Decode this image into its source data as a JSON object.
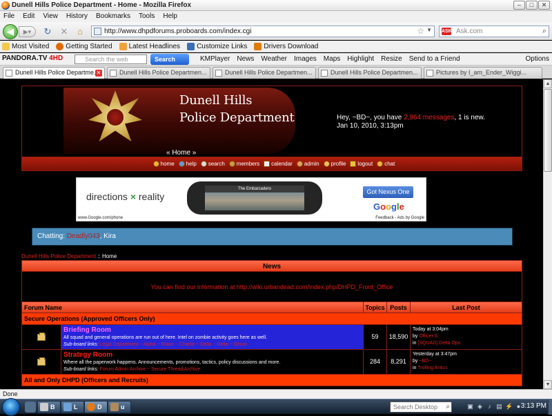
{
  "window": {
    "title": "Dunell Hills Police Department - Home - Mozilla Firefox"
  },
  "menu": [
    "File",
    "Edit",
    "View",
    "History",
    "Bookmarks",
    "Tools",
    "Help"
  ],
  "navbar": {
    "url": "http://www.dhpdforums.proboards.com/index.cgi",
    "search_placeholder": "Ask.com",
    "search_engine_label": "ASK"
  },
  "bookmarks": [
    {
      "label": "Most Visited",
      "icon": "folder-icon",
      "color": "#f2c94c"
    },
    {
      "label": "Getting Started",
      "icon": "firefox-icon",
      "color": "#e06a00"
    },
    {
      "label": "Latest Headlines",
      "icon": "rss-icon",
      "color": "#f2a23a"
    },
    {
      "label": "Customize Links",
      "icon": "page-icon",
      "color": "#3a6fb5"
    },
    {
      "label": "Drivers Download",
      "icon": "driver-icon",
      "color": "#e07b00"
    }
  ],
  "toolbar2": {
    "pandora": "PANDORA.TV",
    "pandora_4hd": "4HD",
    "search_placeholder": "Search the web",
    "search_button": "Search",
    "items": [
      "KMPlayer",
      "News",
      "Weather",
      "Images",
      "Maps",
      "Highlight",
      "Resize",
      "Send to a Friend"
    ],
    "options": "Options"
  },
  "tabs": [
    {
      "label": "Dunell Hills Police Departme...",
      "active": true
    },
    {
      "label": "Dunell Hills Police Departmen...",
      "active": false
    },
    {
      "label": "Dunell Hills Police Departmen...",
      "active": false
    },
    {
      "label": "Dunell Hills Police Departmen...",
      "active": false
    },
    {
      "label": "Pictures by I_am_Ender_Wiggi...",
      "active": false
    }
  ],
  "header": {
    "dept_line1": "Dunell Hills",
    "dept_line2": "Police Department",
    "greeting": "Hey, ~BD~, you have",
    "messages_count": "2,964 messages",
    "new_text": ", 1 is new.",
    "date": "Jan 10, 2010, 3:13pm",
    "home_link": "« Home »"
  },
  "forum_nav": [
    "home",
    "help",
    "search",
    "members",
    "calendar",
    "admin",
    "profile",
    "logout",
    "chat"
  ],
  "ad": {
    "headline_left": "directions",
    "headline_x": "×",
    "headline_right": "reality",
    "phone_caption": "The Embarcadero",
    "button": "Got Nexus One",
    "logo": [
      "G",
      "o",
      "o",
      "g",
      "l",
      "e"
    ],
    "url": "www.Google.com/phone",
    "attribution": "Feedback - Ads by Google"
  },
  "chat": {
    "label": "Chatting:",
    "user1": "Deadly043",
    "user2": ", Kira"
  },
  "breadcrumb": {
    "link": "Dunell Hills Police Department",
    "sep": " :: ",
    "current": "Home"
  },
  "news": {
    "title": "News",
    "body": "You can find our information at http://wiki.urbandead.com/index.php/DHPD_Front_Office"
  },
  "table": {
    "headers": {
      "forum": "Forum Name",
      "topics": "Topics",
      "posts": "Posts",
      "last": "Last Post"
    },
    "cat1": "Secure Operations (Approved Officers Only)",
    "cat2": "All and Only DHPD (Officers and Recruits)",
    "rows": [
      {
        "name": "Briefing Room",
        "desc": "All squad and general operations are run out of here. Intel on zombie activity goes here as well.",
        "sub_label": "Sub-board links:",
        "sub_links": "Legal Department ~ Alpha ~ Bravo ~ Charlie ~ Delta ~ Delta ~ Ghost",
        "topics": "59",
        "posts": "18,590",
        "last_time": "Today at 3:04pm",
        "last_by_label": "by",
        "last_by": "Officer S",
        "last_in_label": "in",
        "last_in": "[SQUAD] Delta Ops"
      },
      {
        "name": "Strategy Room",
        "desc": "Where all the paperwork happens. Announcements, promotions, tactics, policy discussions and more.",
        "sub_label": "Sub-board links:",
        "sub_links": "Forum Admin Archive ~ Secure Thread Archive",
        "topics": "284",
        "posts": "8,291",
        "last_time": "Yesterday at 3:47pm",
        "last_by_label": "by",
        "last_by": "~BD~",
        "last_in_label": "in",
        "last_in": "Trolling Antics"
      }
    ]
  },
  "status": "Done",
  "taskbar": {
    "buttons": [
      "B",
      "L",
      "D",
      "u"
    ],
    "search": "Search Desktop",
    "clock": "3:13 PM"
  }
}
